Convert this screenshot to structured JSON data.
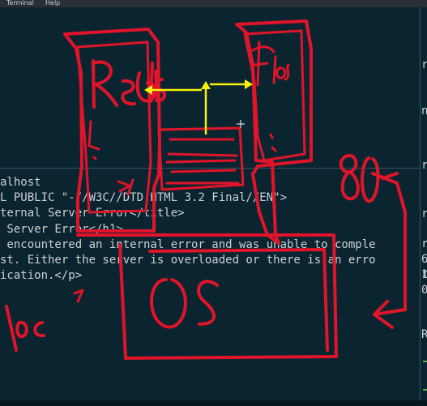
{
  "menu": {
    "terminal": "Terminal",
    "help": "Help"
  },
  "terminal": {
    "lines": [
      "alhost",
      "L PUBLIC \"-//W3C//DTD HTML 3.2 Final//EN\">",
      "ternal Server Error</title>",
      " Server Error</h1>",
      " encountered an internal error and was unable to comple",
      "st. Either the server is overloaded or there is an erro",
      "ication.</p>"
    ]
  },
  "right_pane": {
    "chars": [
      "r",
      "n",
      "r",
      "r",
      "r",
      "r",
      "6",
      "1",
      "0",
      "",
      "R"
    ]
  },
  "annotations": {
    "ink_color": "#e0142a",
    "arrow_color": "#f4f20a",
    "label_redis": "Redis",
    "label_flask": "flask",
    "label_port": "80",
    "label_os": "OS",
    "label_loc": "loc"
  }
}
